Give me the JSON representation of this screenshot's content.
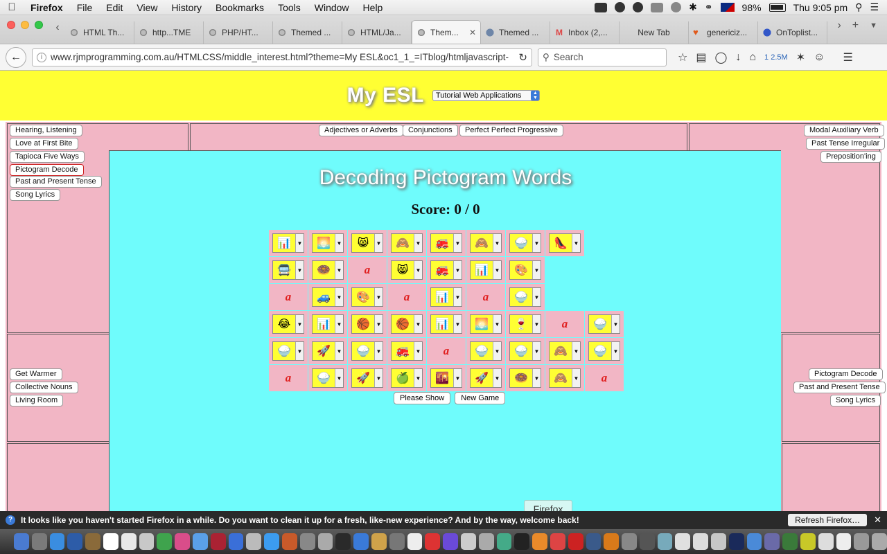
{
  "menubar": {
    "app": "Firefox",
    "items": [
      "File",
      "Edit",
      "View",
      "History",
      "Bookmarks",
      "Tools",
      "Window",
      "Help"
    ],
    "battery": "98%",
    "clock": "Thu 9:05 pm"
  },
  "tabs": [
    {
      "label": "HTML Th...",
      "favicon": "default"
    },
    {
      "label": "http...TME",
      "favicon": "default"
    },
    {
      "label": "PHP/HT...",
      "favicon": "default"
    },
    {
      "label": "Themed ...",
      "favicon": "default"
    },
    {
      "label": "HTML/Ja...",
      "favicon": "default"
    },
    {
      "label": "Them...",
      "favicon": "default",
      "active": true
    },
    {
      "label": "Themed ...",
      "favicon": "globe"
    },
    {
      "label": "Inbox (2,...",
      "favicon": "gmail"
    },
    {
      "label": "New Tab",
      "favicon": "none"
    },
    {
      "label": "genericiz...",
      "favicon": "heart"
    },
    {
      "label": "OnToplist...",
      "favicon": "ot"
    }
  ],
  "navbar": {
    "url": "www.rjmprogramming.com.au/HTMLCSS/middle_interest.html?theme=My ESL&oc1_1_=ITblog/htmljavascript-hearir",
    "search_placeholder": "Search",
    "counter": "2.5M",
    "counter_prefix": "1"
  },
  "page": {
    "site_title": "My ESL",
    "site_select_value": "Tutorial Web Applications",
    "left_top_buttons": [
      "Hearing, Listening",
      "Love at First Bite",
      "Tapioca Five Ways",
      "Pictogram Decode",
      "Past and Present Tense",
      "Song Lyrics"
    ],
    "center_top_buttons": [
      "Adjectives or Adverbs",
      "Conjunctions",
      "Perfect Perfect Progressive"
    ],
    "right_top_buttons": [
      "Modal Auxiliary Verb",
      "Past Tense Irregular",
      "Preposition'ing"
    ],
    "left_mid_buttons": [
      "Get Warmer",
      "Collective Nouns",
      "Living Room"
    ],
    "right_mid_buttons": [
      "Pictogram Decode",
      "Past and Present Tense",
      "Song Lyrics"
    ],
    "game_title": "Decoding Pictogram Words",
    "score": "Score: 0 / 0",
    "grid": [
      [
        "📊",
        "🌅",
        "😸",
        "🙈",
        "🚒",
        "🙈",
        "🍚",
        "👠"
      ],
      [
        "🚍",
        "🍩",
        "a",
        "😸",
        "🚒",
        "📊",
        "🎨"
      ],
      [
        "a",
        "🚙",
        "🎨",
        "a",
        "📊",
        "a",
        "🍚"
      ],
      [
        "😂",
        "📊",
        "🏀",
        "🏀",
        "📊",
        "🌅",
        "🍷",
        "a",
        "🍚"
      ],
      [
        "🍚",
        "🚀",
        "🍚",
        "🚒",
        "a",
        "🍚",
        "🍚",
        "🙈",
        "🍚"
      ],
      [
        "a",
        "🍚",
        "🚀",
        "🍏",
        "🌇",
        "🚀",
        "🍩",
        "🙈",
        "a"
      ]
    ],
    "show_button": "Please Show",
    "new_game_button": "New Game"
  },
  "notification": {
    "message": "It looks like you haven't started Firefox in a while. Do you want to clean it up for a fresh, like-new experience? And by the way, welcome back!",
    "button": "Refresh Firefox…"
  },
  "tooltip": "Firefox"
}
